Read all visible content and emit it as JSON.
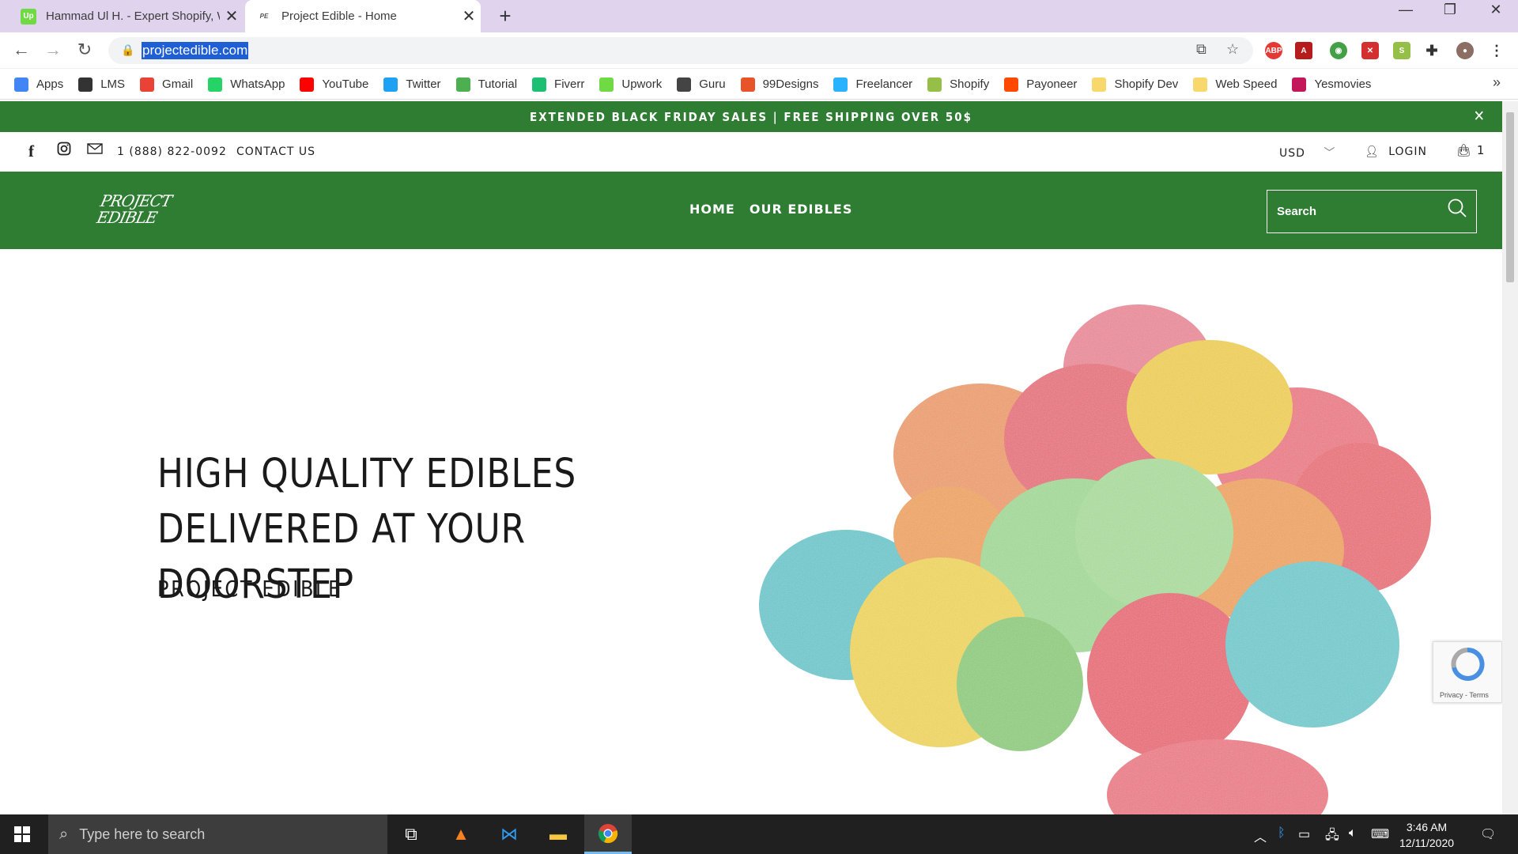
{
  "browser": {
    "tabs": [
      {
        "title": "Hammad Ul H. - Expert Shopify, W",
        "icon": "upwork-icon"
      },
      {
        "title": "Project Edible - Home",
        "icon": "project-edible-favicon"
      }
    ],
    "url": "projectedible.com",
    "bookmarks": [
      {
        "label": "Apps",
        "icon": "apps-grid-icon",
        "color": "#4285f4"
      },
      {
        "label": "LMS",
        "icon": "globe-icon",
        "color": "#333333"
      },
      {
        "label": "Gmail",
        "icon": "gmail-icon",
        "color": "#ea4335"
      },
      {
        "label": "WhatsApp",
        "icon": "whatsapp-icon",
        "color": "#25d366"
      },
      {
        "label": "YouTube",
        "icon": "youtube-icon",
        "color": "#ff0000"
      },
      {
        "label": "Twitter",
        "icon": "twitter-icon",
        "color": "#1da1f2"
      },
      {
        "label": "Tutorial",
        "icon": "tutorial-icon",
        "color": "#4caf50"
      },
      {
        "label": "Fiverr",
        "icon": "fiverr-icon",
        "color": "#1dbf73"
      },
      {
        "label": "Upwork",
        "icon": "upwork-icon",
        "color": "#6fda44"
      },
      {
        "label": "Guru",
        "icon": "guru-icon",
        "color": "#444444"
      },
      {
        "label": "99Designs",
        "icon": "99designs-icon",
        "color": "#e8542a"
      },
      {
        "label": "Freelancer",
        "icon": "freelancer-icon",
        "color": "#29b2fe"
      },
      {
        "label": "Shopify",
        "icon": "shopify-icon",
        "color": "#95bf47"
      },
      {
        "label": "Payoneer",
        "icon": "payoneer-icon",
        "color": "#ff4800"
      },
      {
        "label": "Shopify Dev",
        "icon": "folder-icon",
        "color": "#f9d86b"
      },
      {
        "label": "Web Speed",
        "icon": "folder-icon",
        "color": "#f9d86b"
      },
      {
        "label": "Yesmovies",
        "icon": "yesmovies-icon",
        "color": "#c2185b"
      }
    ]
  },
  "site": {
    "announcement": "EXTENDED BLACK FRIDAY SALES | FREE SHIPPING OVER 50$",
    "phone": "1 (888) 822-0092",
    "contact": "CONTACT US",
    "currency": "USD",
    "login": "LOGIN",
    "cart_count": "1",
    "logo_line1": "PROJECT",
    "logo_line2": "EDIBLE",
    "nav": [
      "HOME",
      "OUR EDIBLES"
    ],
    "search_placeholder": "Search",
    "hero_title": "HIGH QUALITY EDIBLES DELIVERED AT YOUR DOORSTEP",
    "hero_subtitle": "PROJECT EDIBLE",
    "recaptcha_text": "Privacy - Terms",
    "brand_color": "#2e7d32"
  },
  "taskbar": {
    "search_placeholder": "Type here to search",
    "time": "3:46 AM",
    "date": "12/11/2020"
  }
}
